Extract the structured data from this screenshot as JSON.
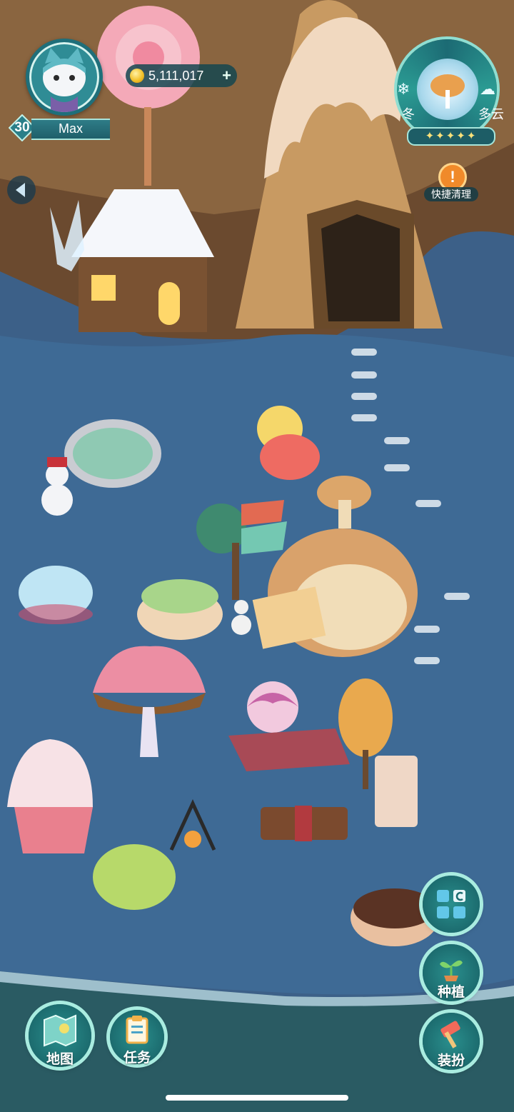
{
  "player": {
    "level": "30",
    "name": "Max"
  },
  "currency": {
    "coins": "5,111,017",
    "add_symbol": "+"
  },
  "weather": {
    "season": "冬",
    "condition": "多云",
    "stars": "✦✦✦✦✦"
  },
  "quick_clean": {
    "label": "快捷清理",
    "icon_glyph": "!"
  },
  "buttons": {
    "plant": "种植",
    "dress_up": "装扮",
    "map": "地图",
    "task": "任务"
  },
  "icons": [
    "back-arrow-icon",
    "coin-icon",
    "snowflake-icon",
    "cloud-icon",
    "alert-icon",
    "build-grid-icon",
    "sprout-icon",
    "hammer-icon",
    "map-icon",
    "clipboard-icon"
  ],
  "colors": {
    "hud_teal": "#1c6c6f",
    "hud_border": "#a9ece0",
    "alert_orange": "#f08a2a",
    "coin_gold": "#f2c12a"
  }
}
